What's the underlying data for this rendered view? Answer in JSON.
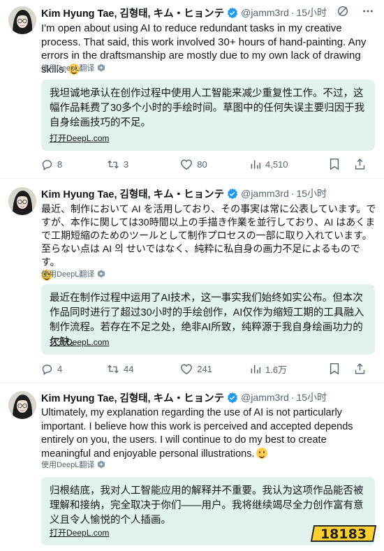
{
  "author": {
    "name": "Kim Hyung Tae, 김형태, キム・ヒョンテ",
    "handle": "@jamm3rd",
    "verified_color": "#1d9bf0"
  },
  "tweets": [
    {
      "time": "15小时",
      "text": "I'm open about using AI to reduce redundant tasks in my creative process. That said, this work involved 30+ hours of hand-painting. Any errors in the draftsmanship are mostly due to my own lack of drawing skills.",
      "translate_label": "使用DeepL翻译",
      "translation": "我坦诚地承认在创作过程中使用人工智能来减少重复性工作。不过，这幅作品耗费了30多个小时的手绘时间。草图中的任何失误主要归因于我自身绘画技巧的不足。",
      "translation_link": "打开DeepL.com",
      "stats": {
        "replies": "8",
        "retweets": "3",
        "likes": "80",
        "views": "4,510"
      }
    },
    {
      "time": "15小时",
      "text": "最近、制作において AI を活用しており、その事実は常に公表しています。ですが、本作に関しては30時間以上の手描き作業を並行しており、AI はあくまで工期短縮のためのツールとして制作プロセスの一部に取り入れています。至らない点は AI 의 せいではなく、純粋に私自身の画力不足によるものです。",
      "translate_label": "使用DeepL翻译",
      "translation": "最近在制作过程中运用了AI技术，这一事实我们始终如实公布。但本次作品同时进行了超过30小时的手绘创作，AI仅作为缩短工期的工具融入制作流程。若存在不足之处，绝非AI所致，纯粹源于我自身绘画功力的欠缺。",
      "translation_link": "打开DeepL.com",
      "stats": {
        "replies": "4",
        "retweets": "44",
        "likes": "241",
        "views": "1.6万"
      }
    },
    {
      "time": "15小时",
      "text": "Ultimately, my explanation regarding the use of AI is not particularly important. I believe how this work is perceived and accepted depends entirely on you, the users. I will continue to do my best to create meaningful and enjoyable personal illustrations.",
      "translate_label": "使用DeepL翻译",
      "translation": "归根结底，我对人工智能应用的解释并不重要。我认为这项作品能否被理解和接纳，完全取决于你们——用户。我将继续竭尽全力创作富有意义且令人愉悦的个人插画。",
      "translation_link": "打开DeepL.com"
    }
  ],
  "watermark": "18183",
  "colors": {
    "translation_bg": "#e3f2ef",
    "muted": "#536471",
    "text": "#0f1419"
  }
}
